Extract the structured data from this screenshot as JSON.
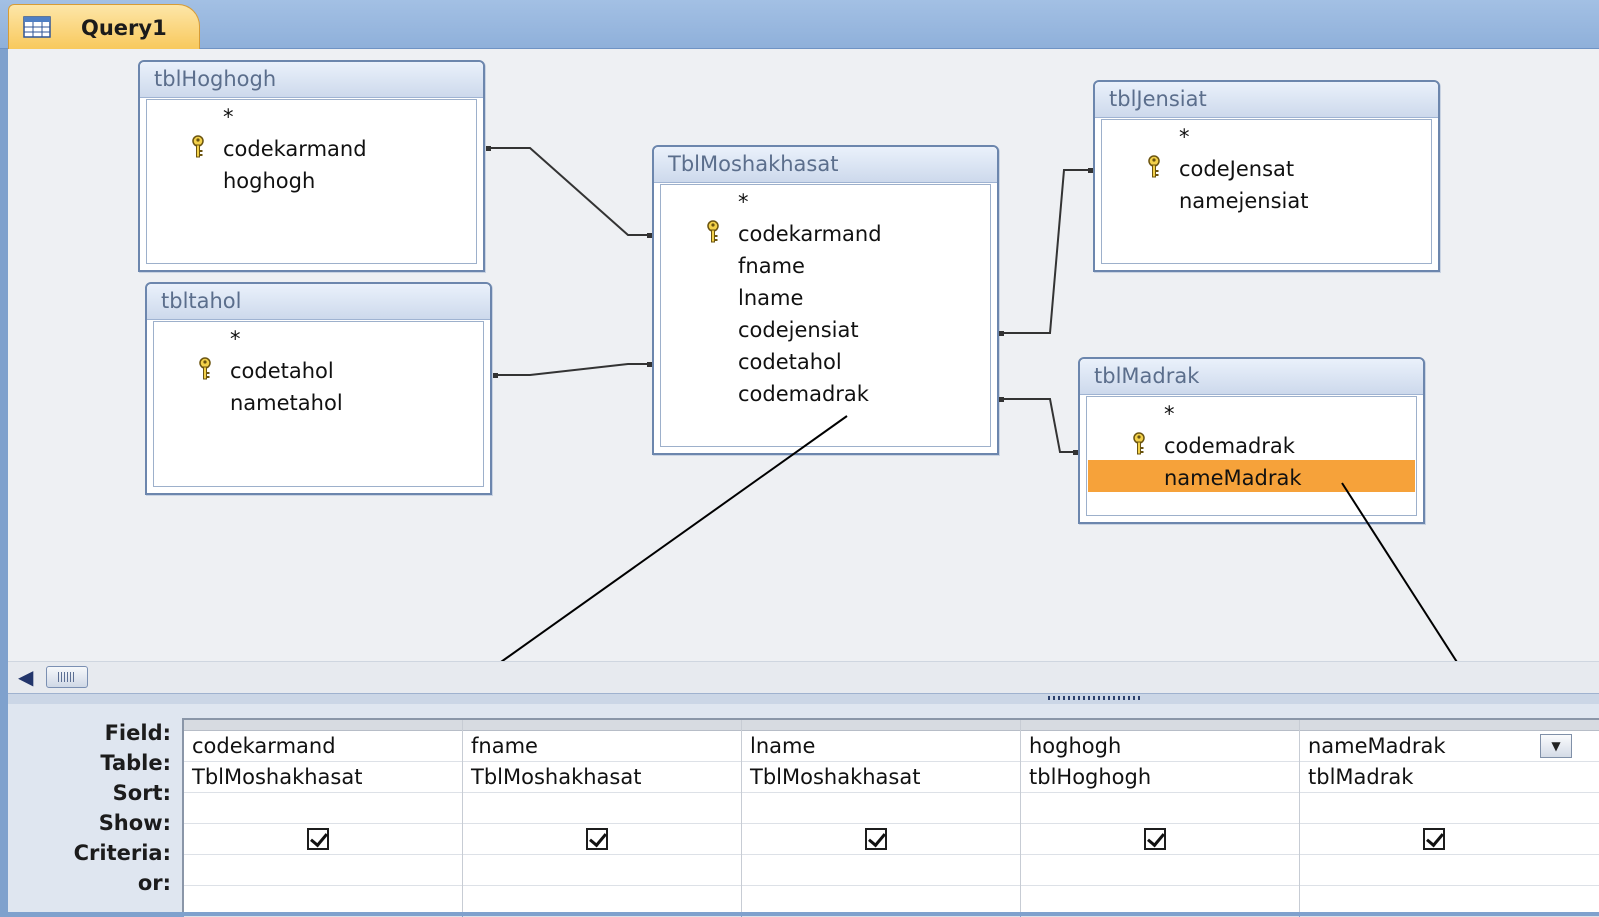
{
  "tab": {
    "label": "Query1",
    "icon": "query-icon"
  },
  "tables": {
    "hoghogh": {
      "title": "tblHoghogh",
      "fields": [
        "*",
        "codekarmand",
        "hoghogh"
      ],
      "key_field": "codekarmand"
    },
    "tahol": {
      "title": "tbltahol",
      "fields": [
        "*",
        "codetahol",
        "nametahol"
      ],
      "key_field": "codetahol"
    },
    "moshakhasat": {
      "title": "TblMoshakhasat",
      "fields": [
        "*",
        "codekarmand",
        "fname",
        "lname",
        "codejensiat",
        "codetahol",
        "codemadrak"
      ],
      "key_field": "codekarmand"
    },
    "jensiat": {
      "title": "tblJensiat",
      "fields": [
        "*",
        "codeJensat",
        "namejensiat"
      ],
      "key_field": "codeJensat"
    },
    "madrak": {
      "title": "tblMadrak",
      "fields": [
        "*",
        "codemadrak",
        "nameMadrak"
      ],
      "key_field": "codemadrak",
      "selected_field": "nameMadrak"
    }
  },
  "grid": {
    "row_labels": [
      "Field:",
      "Table:",
      "Sort:",
      "Show:",
      "Criteria:",
      "or:"
    ],
    "columns": [
      {
        "field": "codekarmand",
        "table": "TblMoshakhasat",
        "sort": "",
        "show": true,
        "criteria": "",
        "or": ""
      },
      {
        "field": "fname",
        "table": "TblMoshakhasat",
        "sort": "",
        "show": true,
        "criteria": "",
        "or": ""
      },
      {
        "field": "lname",
        "table": "TblMoshakhasat",
        "sort": "",
        "show": true,
        "criteria": "",
        "or": ""
      },
      {
        "field": "hoghogh",
        "table": "tblHoghogh",
        "sort": "",
        "show": true,
        "criteria": "",
        "or": ""
      },
      {
        "field": "nameMadrak",
        "table": "tblMadrak",
        "sort": "",
        "show": true,
        "criteria": "",
        "or": ""
      }
    ]
  },
  "colors": {
    "selection": "#f6a23a",
    "tab": "#f8c95d",
    "tab_strip": "#8fb0da"
  }
}
